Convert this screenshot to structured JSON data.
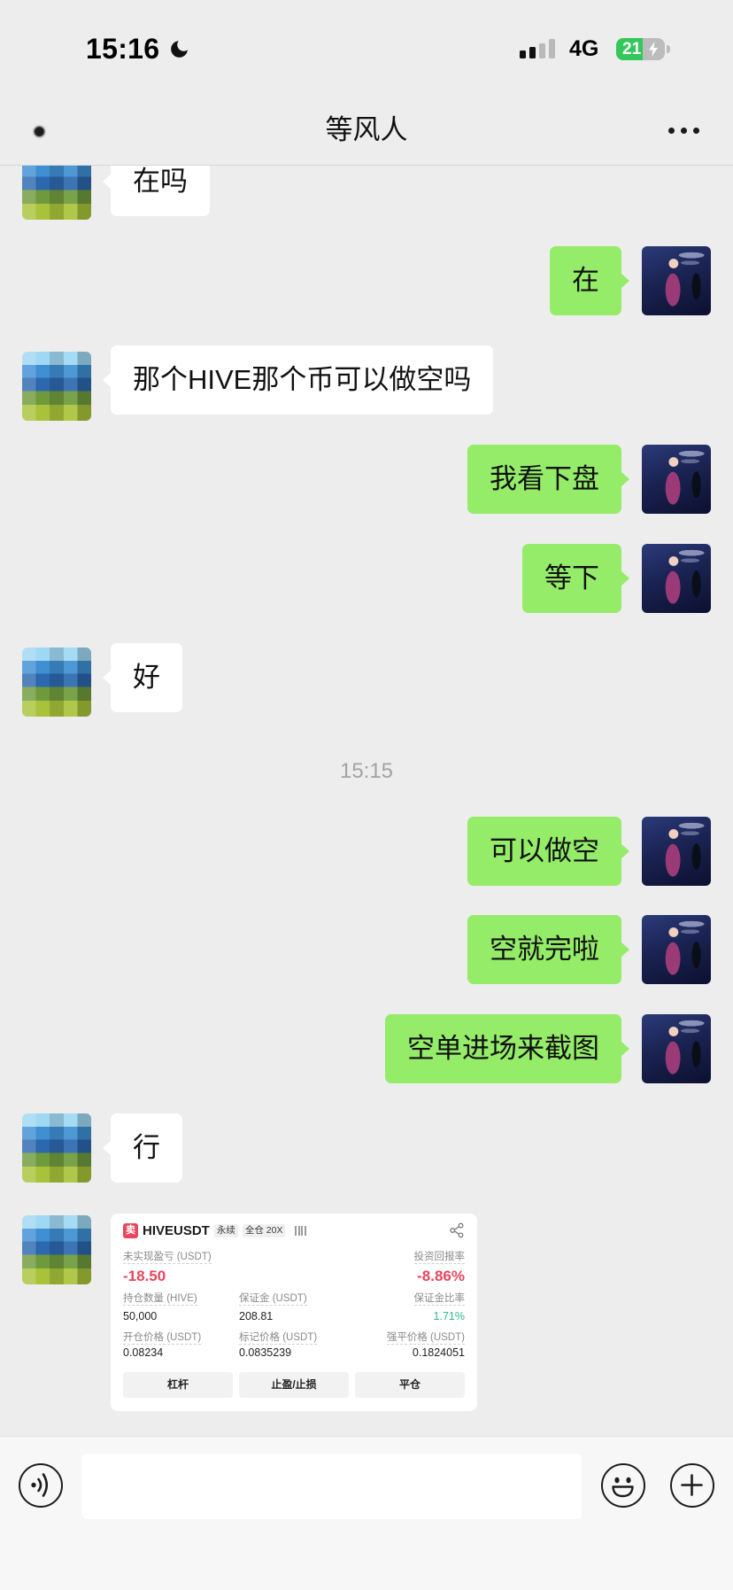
{
  "status_bar": {
    "time": "15:16",
    "network": "4G",
    "battery": "21",
    "signal_strength": {
      "level": 2,
      "max": 4
    },
    "icons": [
      "moon-icon",
      "signal-strength-icon",
      "battery-icon",
      "charging-bolt-icon"
    ]
  },
  "nav": {
    "title": "等风人",
    "icons": [
      "back-icon",
      "more-icon"
    ]
  },
  "chat": {
    "messages": [
      {
        "sender": "contact",
        "text": "在吗"
      },
      {
        "sender": "me",
        "text": "在"
      },
      {
        "sender": "contact",
        "text": "那个HIVE那个币可以做空吗"
      },
      {
        "sender": "me",
        "text": "我看下盘"
      },
      {
        "sender": "me",
        "text": "等下"
      },
      {
        "sender": "contact",
        "text": "好"
      },
      {
        "sender": "me",
        "text": "可以做空"
      },
      {
        "sender": "me",
        "text": "空就完啦"
      },
      {
        "sender": "me",
        "text": "空单进场来截图"
      },
      {
        "sender": "contact",
        "text": "行"
      }
    ],
    "timestamp": "15:15",
    "position_card": {
      "sender": "contact",
      "side_badge": "卖",
      "symbol": "HIVEUSDT",
      "contract_tag": "永续",
      "margin_tag": "全仓 20X",
      "unrealized_pnl": {
        "label": "未实现盈亏 (USDT)",
        "value": "-18.50"
      },
      "roi": {
        "label": "投资回报率",
        "value": "-8.86%"
      },
      "position_size": {
        "label": "持仓数量 (HIVE)",
        "value": "50,000"
      },
      "margin": {
        "label": "保证金 (USDT)",
        "value": "208.81"
      },
      "margin_ratio": {
        "label": "保证金比率",
        "value": "1.71%"
      },
      "entry_price": {
        "label": "开仓价格 (USDT)",
        "value": "0.08234"
      },
      "mark_price": {
        "label": "标记价格 (USDT)",
        "value": "0.0835239"
      },
      "liquidation_price": {
        "label": "强平价格 (USDT)",
        "value": "0.1824051"
      },
      "buttons": [
        "杠杆",
        "止盈/止损",
        "平仓"
      ],
      "icons": [
        "adl-indicator-icon",
        "share-icon"
      ]
    }
  },
  "input_bar": {
    "value": "",
    "icons": [
      "voice-icon",
      "emoji-icon",
      "plus-icon"
    ]
  },
  "colors": {
    "background": "#EDEDED",
    "bubble_me": "#95EC69",
    "bubble_contact": "#FFFFFF",
    "loss_red": "#E8465E",
    "gain_green": "#2EBD85",
    "battery_green": "#34C759"
  }
}
